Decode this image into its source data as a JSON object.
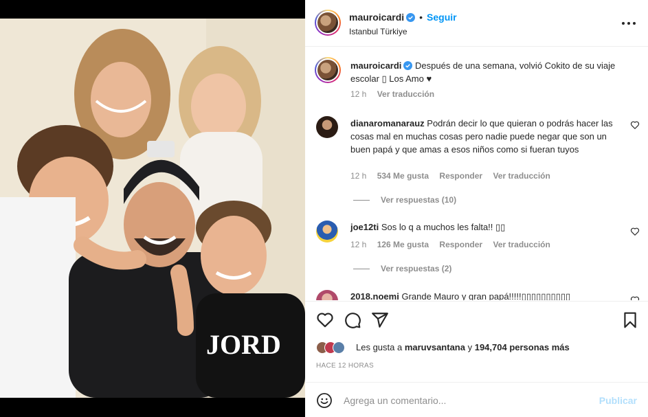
{
  "post": {
    "username": "mauroicardi",
    "follow_separator": "•",
    "follow_label": "Seguir",
    "location": "Istanbul Türkiye",
    "caption": {
      "username": "mauroicardi",
      "text": "Después de una semana, volvió Cokito de su viaje escolar ▯ Los Amo ♥",
      "time": "12 h",
      "translate": "Ver traducción"
    }
  },
  "comments": [
    {
      "username": "dianaromanarauz",
      "text": "Podrán decir lo que quieran o podrás hacer las cosas mal en muchas cosas pero nadie puede negar que son un buen papá y que amas a esos niños como si fueran tuyos",
      "time": "12 h",
      "likes": "534 Me gusta",
      "reply": "Responder",
      "translate": "Ver traducción",
      "view_replies": "Ver respuestas (10)"
    },
    {
      "username": "joe12ti",
      "text": "Sos lo q a muchos les falta!! ▯▯",
      "time": "12 h",
      "likes": "126 Me gusta",
      "reply": "Responder",
      "translate": "Ver traducción",
      "view_replies": "Ver respuestas (2)"
    },
    {
      "username": "2018.noemi",
      "text": "Grande Mauro y gran papá!!!!!▯▯▯▯▯▯▯▯▯▯"
    }
  ],
  "actions": {
    "icons": [
      "heart-icon",
      "comment-icon",
      "share-icon",
      "bookmark-icon"
    ],
    "likes_prefix": "Les gusta a ",
    "likes_user": "maruvsantana",
    "likes_mid": " y ",
    "likes_count": "194,704 personas más",
    "timestamp": "HACE 12 HORAS"
  },
  "add_comment": {
    "placeholder": "Agrega un comentario...",
    "publish_label": "Publicar"
  },
  "colors": {
    "accent": "#0095f6",
    "publish_disabled": "#b2dffc",
    "muted": "#8e8e8e",
    "text": "#262626"
  }
}
